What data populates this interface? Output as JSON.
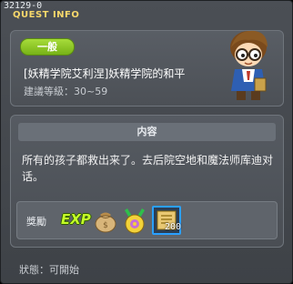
{
  "window": {
    "id_text": "32129-0",
    "title": "QUEST INFO"
  },
  "quest": {
    "tag": "一般",
    "name": "[妖精学院艾利涅]妖精学院的和平",
    "level_label": "建議等級",
    "level_range": "30~59",
    "npc_icon": "npc-boy-with-glasses"
  },
  "content": {
    "header": "内容",
    "text": "所有的孩子都救出来了。去后院空地和魔法师库迪对话。"
  },
  "rewards": {
    "label": "獎勵",
    "items": [
      {
        "icon": "exp-icon",
        "text": "EXP"
      },
      {
        "icon": "money-bag-icon"
      },
      {
        "icon": "medal-icon"
      },
      {
        "icon": "scroll-icon",
        "count": "200"
      }
    ]
  },
  "status": {
    "label": "狀態",
    "value": "可開始"
  },
  "colors": {
    "title": "#f7d86b",
    "tag_green": "#8fcb26",
    "exp_green": "#c4ff28",
    "highlight_blue": "#2aa0ff"
  }
}
